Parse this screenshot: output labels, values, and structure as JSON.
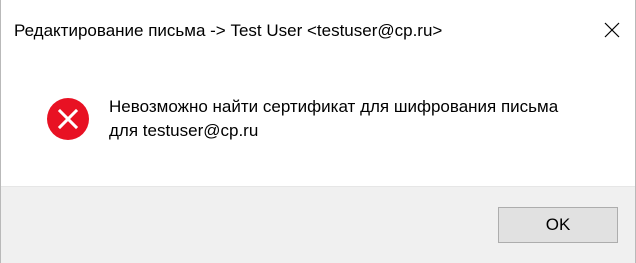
{
  "window": {
    "title": "Редактирование письма -> Test User <testuser@cp.ru>"
  },
  "message": {
    "icon": "error-icon",
    "line1": "Невозможно найти сертификат для шифрования письма",
    "line2": "для testuser@cp.ru"
  },
  "buttons": {
    "ok_label": "OK"
  },
  "colors": {
    "error_red": "#e81123",
    "footer_bg": "#f0f0f0",
    "button_bg": "#e1e1e1",
    "button_border": "#adadad"
  }
}
